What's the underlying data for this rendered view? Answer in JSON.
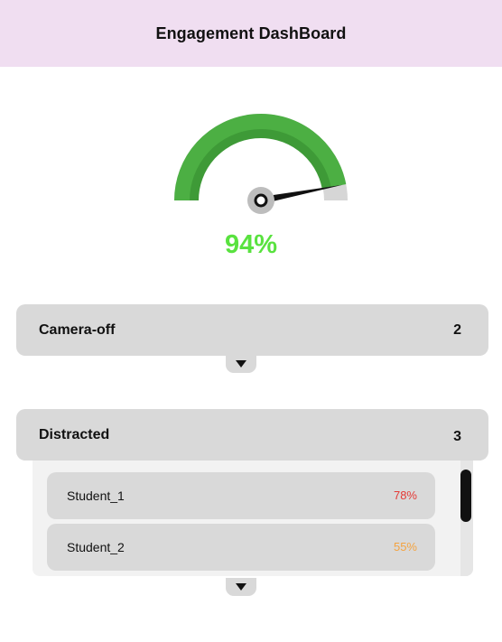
{
  "header": {
    "title": "Engagement DashBoard"
  },
  "gauge": {
    "value_label": "94%",
    "value_fraction": 0.94,
    "colors": {
      "fill_outer": "#4caf43",
      "fill_inner": "#3e9a37",
      "track": "#d6d6d6",
      "needle": "#111111",
      "value_text": "#59e23f"
    }
  },
  "cards": {
    "camera_off": {
      "label": "Camera-off",
      "count": "2"
    },
    "distracted": {
      "label": "Distracted",
      "count": "3",
      "students": [
        {
          "name": "Student_1",
          "percent": "78%",
          "color": "#e53935"
        },
        {
          "name": "Student_2",
          "percent": "55%",
          "color": "#f4a340"
        }
      ]
    }
  },
  "icons": {
    "toggle": "triangle-down-icon"
  }
}
